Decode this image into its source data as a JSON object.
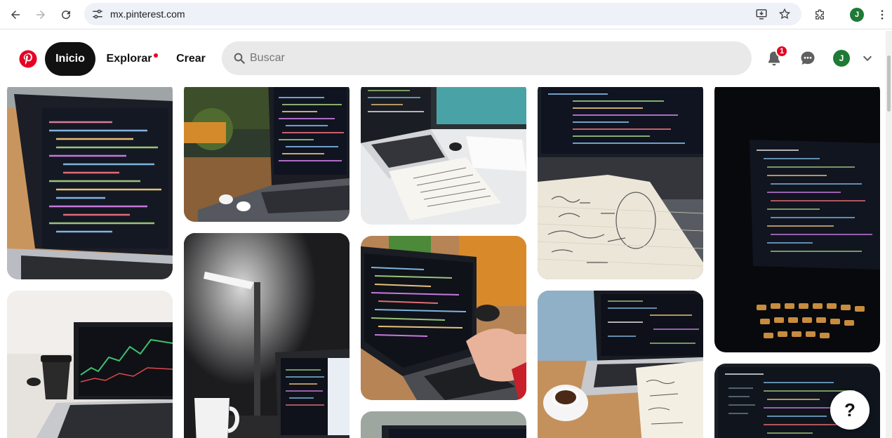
{
  "browser": {
    "url": "mx.pinterest.com",
    "profile_initial": "J"
  },
  "header": {
    "nav": {
      "home": "Inicio",
      "explore": "Explorar",
      "create": "Crear"
    },
    "search_placeholder": "Buscar",
    "notification_count": "1",
    "profile_initial": "J",
    "brand_color": "#e60023"
  },
  "pins": [
    {
      "subject": "laptop with code on desk"
    },
    {
      "subject": "laptop with earbuds in cafe"
    },
    {
      "subject": "laptop and open book"
    },
    {
      "subject": "notebook with handwritten notes and laptop"
    },
    {
      "subject": "laptop in dark with code editor"
    },
    {
      "subject": "laptop with trading chart and coffee cup"
    },
    {
      "subject": "desk lamp and laptop"
    },
    {
      "subject": "hands typing on laptop with code"
    },
    {
      "subject": "laptop notebook and espresso"
    },
    {
      "subject": "laptop with code editor"
    },
    {
      "subject": "laptop partial"
    }
  ],
  "help_label": "?"
}
